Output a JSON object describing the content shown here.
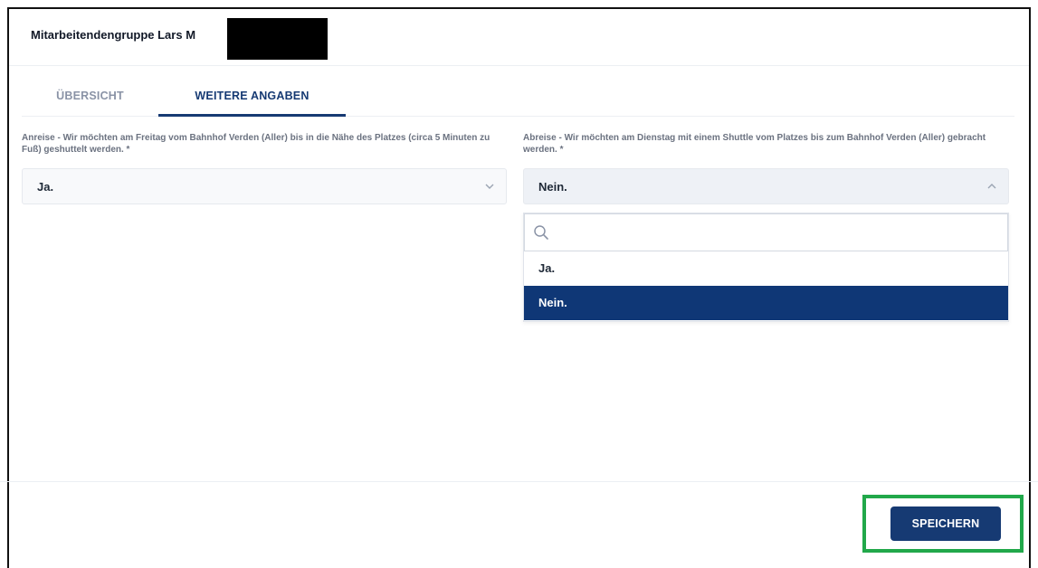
{
  "header": {
    "title": "Mitarbeitendengruppe Lars M"
  },
  "tabs": [
    {
      "label": "ÜBERSICHT",
      "active": false
    },
    {
      "label": "WEITERE ANGABEN",
      "active": true
    }
  ],
  "fields": {
    "arrival": {
      "label": "Anreise - Wir möchten am Freitag vom Bahnhof Verden (Aller) bis in die Nähe des Platzes (circa 5 Minuten zu Fuß) geshuttelt werden. *",
      "value": "Ja.",
      "chevron_icon": "chevron-down-icon"
    },
    "departure": {
      "label": "Abreise - Wir möchten am Dienstag mit einem Shuttle vom Platzes bis zum Bahnhof Verden (Aller) gebracht werden. *",
      "value": "Nein.",
      "chevron_icon": "chevron-up-icon",
      "dropdown": {
        "search_placeholder": "",
        "search_icon": "search-icon",
        "options": [
          "Ja.",
          "Nein."
        ],
        "selected": "Nein."
      }
    }
  },
  "footer": {
    "save_label": "SPEICHERN"
  },
  "colors": {
    "primary": "#163a73",
    "selected_option": "#0f3776",
    "highlight": "#21a84a"
  }
}
